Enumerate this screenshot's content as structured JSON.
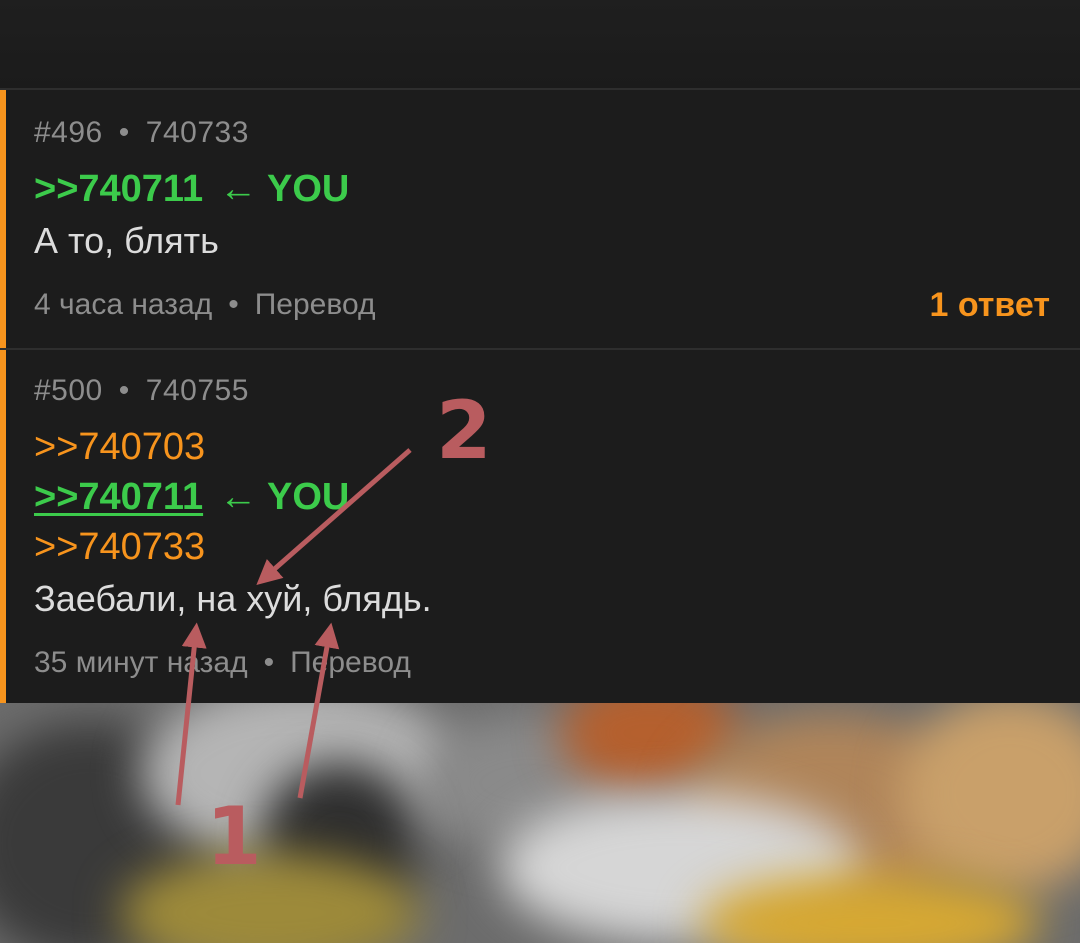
{
  "colors": {
    "accent_orange": "#f7941d",
    "you_green": "#3ccb4b",
    "annotation_red": "#b95c5f",
    "background": "#1c1c1c"
  },
  "posts": [
    {
      "head_num": "#496",
      "head_id": "740733",
      "refs": [
        {
          "text": ">>740711",
          "you_label": "YOU",
          "arrow": "←"
        }
      ],
      "body": "А то, блять",
      "time": "4 часа назад",
      "translate": "Перевод",
      "replies": "1 ответ"
    },
    {
      "head_num": "#500",
      "head_id": "740755",
      "refs": [
        {
          "text": ">>740703"
        },
        {
          "text": ">>740711",
          "you_label": "YOU",
          "arrow": "←"
        },
        {
          "text": ">>740733"
        }
      ],
      "body": "Заебали, на хуй, блядь.",
      "time": "35 минут назад",
      "translate": "Перевод"
    }
  ],
  "separator_dot": "•",
  "annotations": {
    "label_1": "1",
    "label_2": "2"
  },
  "icons": {
    "reply_arrow": "left-arrow-icon"
  }
}
